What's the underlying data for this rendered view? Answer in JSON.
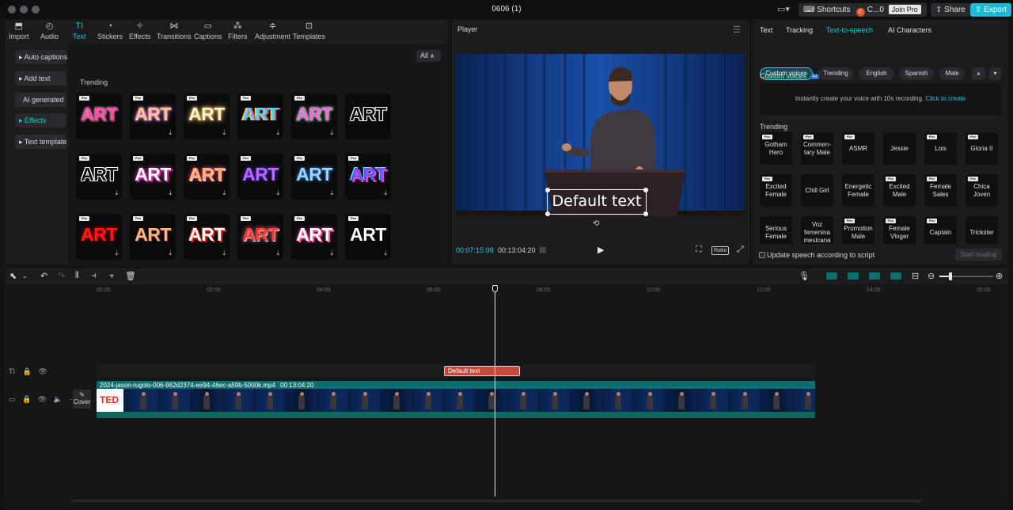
{
  "window": {
    "title": "0606 (1)"
  },
  "topbar": {
    "shortcuts": "Shortcuts",
    "account": "C...0",
    "join_pro": "Join Pro",
    "share": "Share",
    "export": "Export"
  },
  "toolbar": [
    {
      "label": "Import",
      "icon": "import-icon"
    },
    {
      "label": "Audio",
      "icon": "audio-icon"
    },
    {
      "label": "Text",
      "icon": "text-icon"
    },
    {
      "label": "Stickers",
      "icon": "stickers-icon"
    },
    {
      "label": "Effects",
      "icon": "effects-icon"
    },
    {
      "label": "Transitions",
      "icon": "transitions-icon"
    },
    {
      "label": "Captions",
      "icon": "captions-icon"
    },
    {
      "label": "Filters",
      "icon": "filters-icon"
    },
    {
      "label": "Adjustment",
      "icon": "adjustment-icon"
    },
    {
      "label": "Templates",
      "icon": "templates-icon"
    }
  ],
  "text_sidebar": [
    "Auto captions",
    "Add text",
    "AI generated",
    "Effects",
    "Text template"
  ],
  "filter": {
    "label": "All"
  },
  "trending_label": "Trending",
  "art_label": "ART",
  "pro_badge": "Pro",
  "player": {
    "title": "Player",
    "overlay_text": "Default text",
    "current_time": "00:07:15:08",
    "total_time": "00:13:04:20",
    "ratio": "Ratio"
  },
  "right_tabs": [
    "Text",
    "Tracking",
    "Text-to-speech",
    "AI Characters"
  ],
  "voice_filters": [
    "Custom voices",
    "Trending",
    "English",
    "Spanish",
    "Male"
  ],
  "custom_voices": {
    "title": "Custom voices",
    "ai_badge": "AI",
    "description": "Instantly create your voice with 10s recording.",
    "link": "Click to create"
  },
  "trending_voices_label": "Trending",
  "voices": [
    [
      "Gotham Hero",
      "Commen-tary Male",
      "ASMR",
      "Jessie",
      "Lois",
      "Gloria II"
    ],
    [
      "Excited Female",
      "Chill Girl",
      "Energetic Female",
      "Excited Male",
      "Female Sales",
      "Chica Joven"
    ],
    [
      "Serious Female",
      "Voz femenina mexicana",
      "Promotion Male",
      "Female Vloger",
      "Captain",
      "Trickster"
    ]
  ],
  "update_speech": "Update speech according to script",
  "start_reading": "Start reading",
  "timeline": {
    "ticks": [
      "00:00",
      "02:00",
      "04:00",
      "06:00",
      "08:00",
      "10:00",
      "12:00",
      "14:00",
      "16:00"
    ],
    "text_clip": "Default text",
    "video_clip_name": "2024-jason-rugolo-006-962d2374-ee94-46ec-a59b-5000k.mp4",
    "video_clip_duration": "00:13:04:20",
    "cover": "Cover",
    "ted": "TED"
  },
  "colors": {
    "accent": "#28c4d6",
    "export": "#1fb8d6",
    "text_clip": "#c24a3c",
    "video_track": "#0e6f6f"
  }
}
